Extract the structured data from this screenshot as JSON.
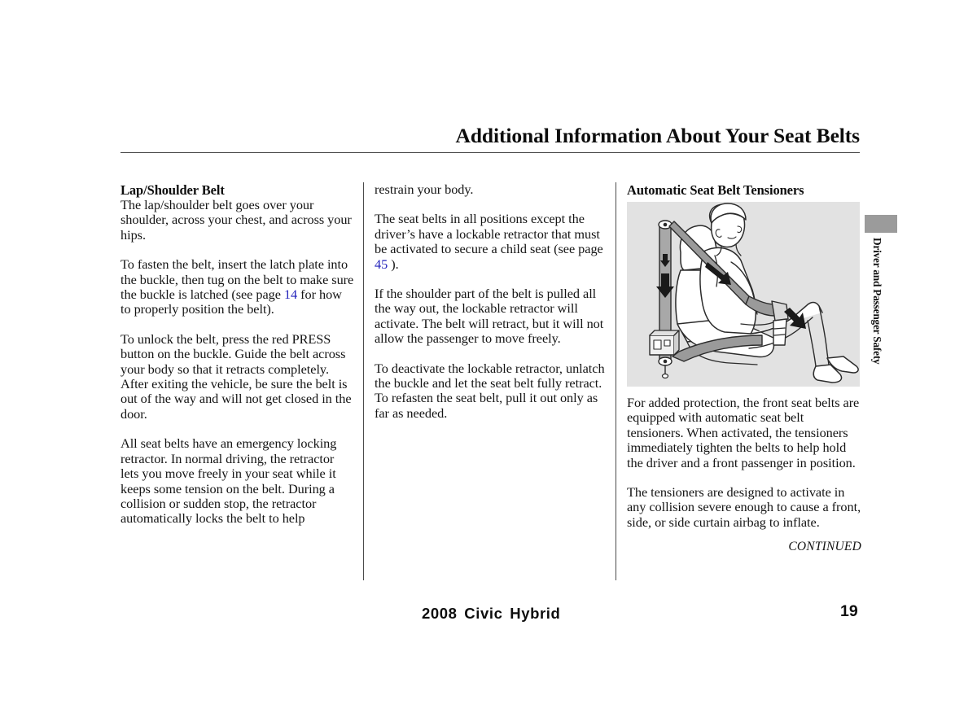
{
  "header": {
    "title": "Additional Information About Your Seat Belts"
  },
  "columns": {
    "left": {
      "heading": "Lap/Shoulder Belt",
      "paragraphs": [
        "The lap/shoulder belt goes over your shoulder, across your chest, and across your hips.",
        "To unlock the belt, press the red PRESS button on the buckle. Guide the belt across your body so that it retracts completely. After exiting the vehicle, be sure the belt is out of the way and will not get closed in the door.",
        "All seat belts have an emergency locking retractor. In normal driving, the retractor lets you move freely in your seat while it keeps some tension on the belt. During a collision or sudden stop, the retractor automatically locks the belt to help"
      ],
      "fasten_paragraph": {
        "before": "To fasten the belt, insert the latch plate into the buckle, then tug on the belt to make sure the buckle is latched (see page ",
        "page_link": "14",
        "after": " for how to properly position the belt)."
      }
    },
    "middle": {
      "paragraphs_before": [
        "restrain your body."
      ],
      "child_seat_paragraph": {
        "before": "The seat belts in all positions except the driver’s have a lockable retractor that must be activated to secure a child seat (see page ",
        "page_link": "45",
        "after": " )."
      },
      "paragraphs_after": [
        "If the shoulder part of the belt is pulled all the way out, the lockable retractor will activate. The belt will retract, but it will not allow the passenger to move freely.",
        "To deactivate the lockable retractor, unlatch the buckle and let the seat belt fully retract. To refasten the seat belt, pull it out only as far as needed."
      ]
    },
    "right": {
      "heading": "Automatic Seat Belt Tensioners",
      "figure_alt": "Seated occupant wearing a lap/shoulder seat belt with arrows showing tensioner pull directions",
      "paragraphs": [
        "For added protection, the front seat belts are equipped with automatic seat belt tensioners. When activated, the tensioners immediately tighten the belts to help hold the driver and a front passenger in position.",
        "The tensioners are designed to activate in any collision severe enough to cause a front, side, or side curtain airbag to inflate."
      ],
      "continued_label": "CONTINUED"
    }
  },
  "side_tab": {
    "label": "Driver and Passenger Safety"
  },
  "footer": {
    "model": "2008  Civic  Hybrid",
    "page_number": "19"
  },
  "colors": {
    "page_link": "#2222bb",
    "figure_background": "#e2e2e2",
    "side_tab": "#9b9b9b",
    "rule": "#4a4a4a",
    "text": "#141414"
  }
}
